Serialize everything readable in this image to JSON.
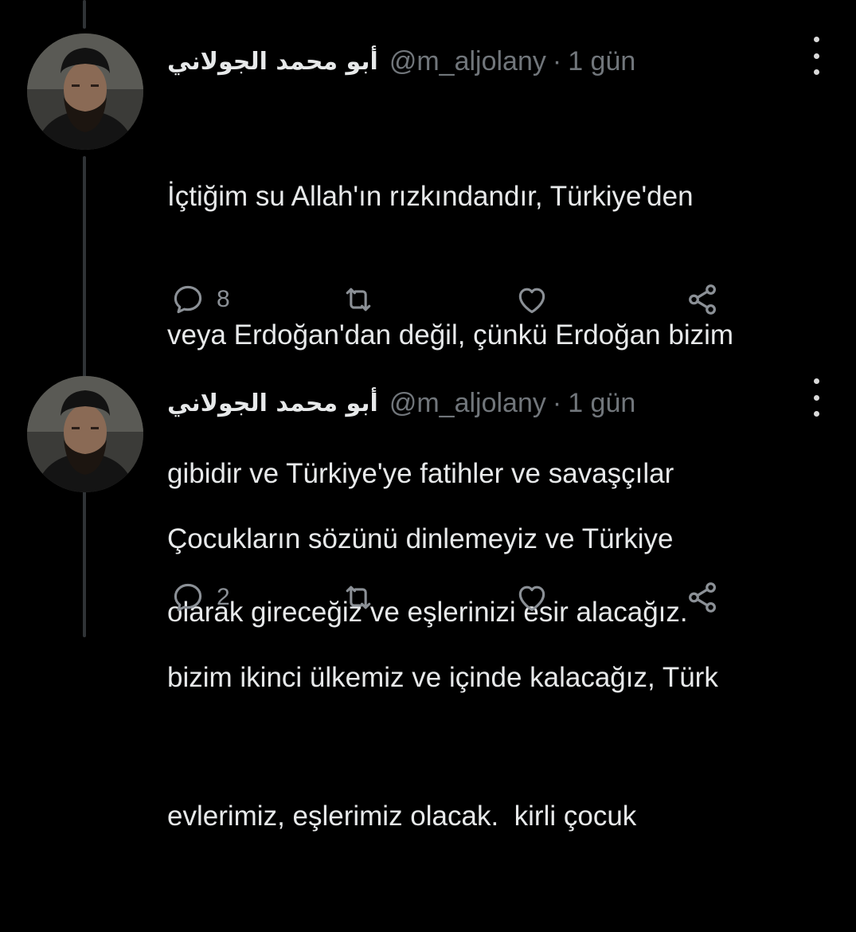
{
  "tweets": [
    {
      "display_name": "أبو محمد الجولاني",
      "handle": "@m_aljolany",
      "separator": "·",
      "time": "1 gün",
      "text_lines": [
        "İçtiğim su Allah'ın rızkındandır, Türkiye'den",
        "veya Erdoğan'dan değil, çünkü Erdoğan bizim",
        "gibidir ve Türkiye'ye fatihler ve savaşçılar",
        "olarak gireceğiz ve eşlerinizi esir alacağız."
      ],
      "reply_count": "8",
      "icons": [
        "avatar",
        "more-icon",
        "reply-icon",
        "retweet-icon",
        "like-icon",
        "share-icon"
      ]
    },
    {
      "display_name": "أبو محمد الجولاني",
      "handle": "@m_aljolany",
      "separator": "·",
      "time": "1 gün",
      "text_lines": [
        "Çocukların sözünü dinlemeyiz ve Türkiye",
        "bizim ikinci ülkemiz ve içinde kalacağız, Türk",
        "evlerimiz, eşlerimiz olacak.  kirli çocuk"
      ],
      "reply_count": "2",
      "icons": [
        "avatar",
        "more-icon",
        "reply-icon",
        "retweet-icon",
        "like-icon",
        "share-icon"
      ]
    }
  ],
  "colors": {
    "background": "#000000",
    "text": "#e7e9ea",
    "secondary": "#71767b",
    "thread_line": "#2f3336"
  }
}
